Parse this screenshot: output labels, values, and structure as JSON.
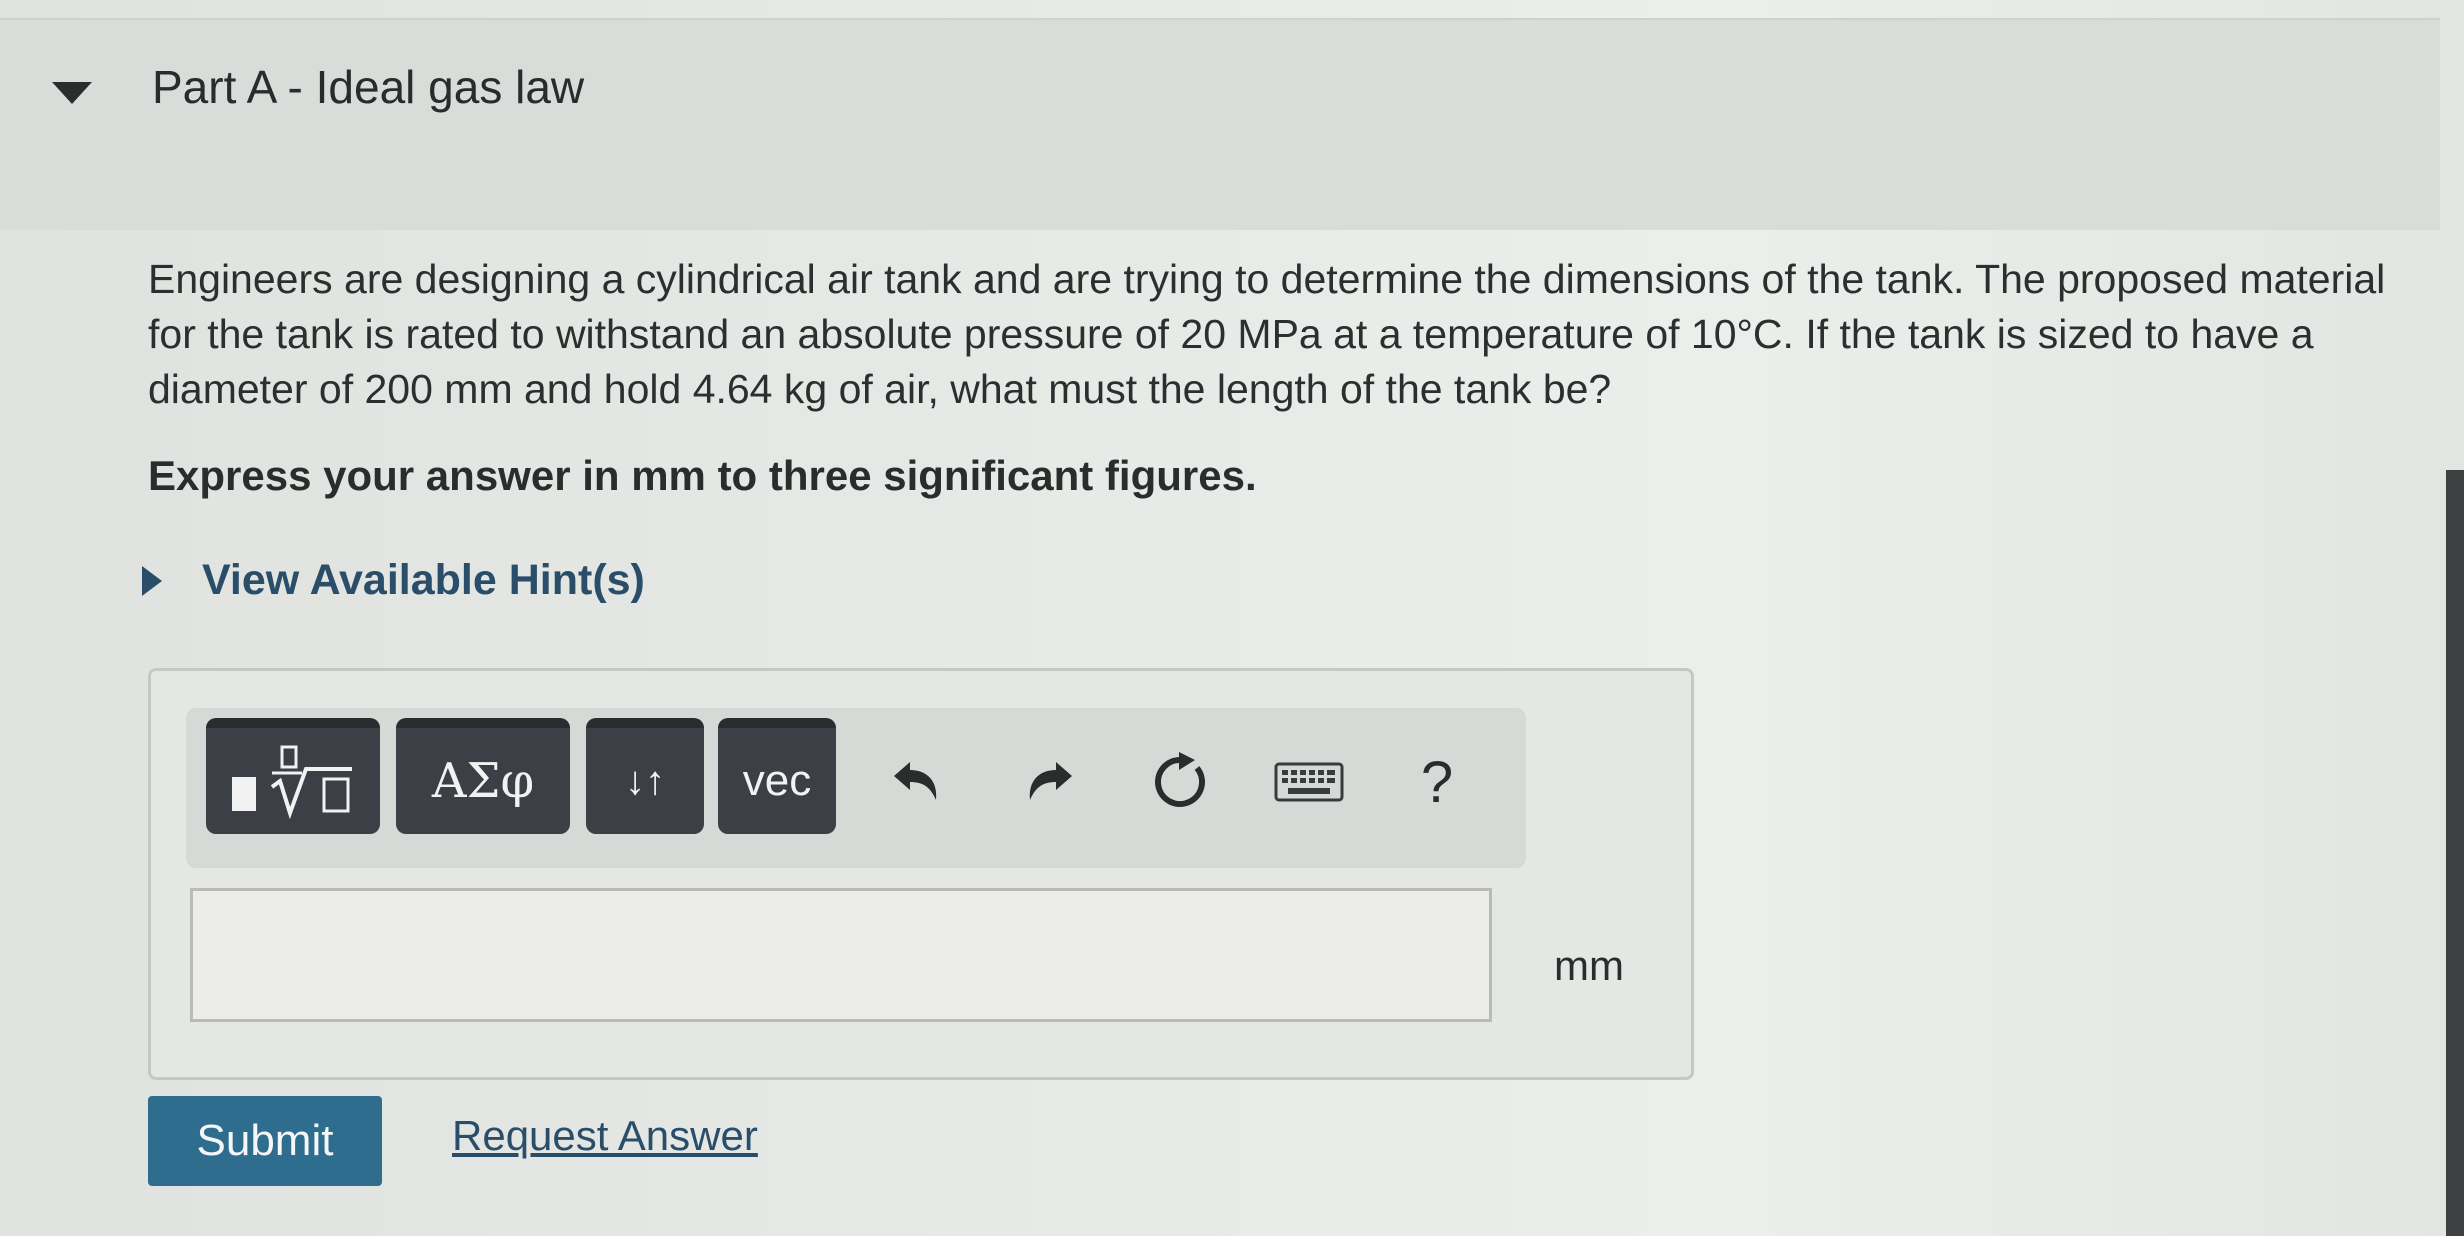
{
  "part": {
    "title": "Part A - Ideal gas law",
    "expanded": true
  },
  "question": {
    "text": "Engineers are designing a cylindrical air tank and are trying to determine the dimensions of the tank. The proposed material for the tank is rated to withstand an absolute pressure of 20 MPa at a temperature of 10°C. If the tank is sized to have a diameter of 200 mm and hold 4.64 kg of air, what must the length of the tank be?",
    "instructions": "Express your answer in mm to three significant figures."
  },
  "hints": {
    "label": "View Available Hint(s)"
  },
  "toolbar": {
    "buttons": [
      {
        "icon": "fraction-sqrt-template-icon"
      },
      {
        "label": "ΑΣφ",
        "icon": "greek-letters-icon"
      },
      {
        "label": "↓↑",
        "icon": "subscript-superscript-icon"
      },
      {
        "label": "vec",
        "icon": "vector-icon"
      }
    ],
    "undo_icon": "undo-icon",
    "redo_icon": "redo-icon",
    "reset_icon": "reset-icon",
    "keyboard_icon": "keyboard-icon",
    "help_label": "?"
  },
  "answer": {
    "value": "",
    "unit": "mm"
  },
  "actions": {
    "submit_label": "Submit",
    "request_answer_label": "Request Answer"
  },
  "colors": {
    "accent": "#2f6d8e",
    "link": "#2a4e69",
    "toolbar_button": "#3c3f45"
  }
}
